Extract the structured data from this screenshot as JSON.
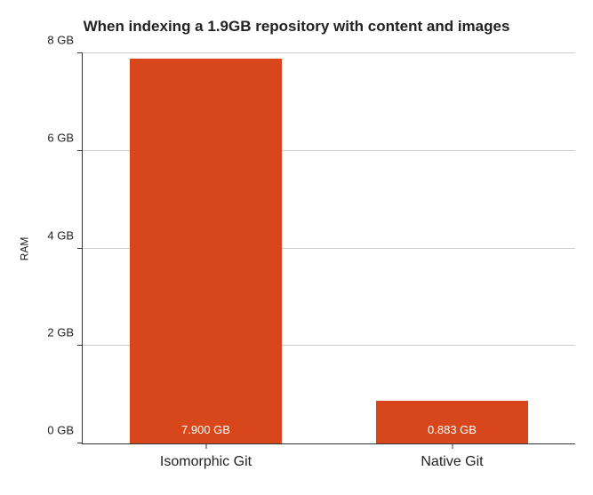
{
  "chart_data": {
    "type": "bar",
    "title": "When indexing a 1.9GB repository with content and images",
    "ylabel": "RAM",
    "xlabel": "",
    "categories": [
      "Isomorphic Git",
      "Native Git"
    ],
    "values": [
      7.9,
      0.883
    ],
    "value_labels": [
      "7.900 GB",
      "0.883 GB"
    ],
    "ylim": [
      0,
      8
    ],
    "y_ticks": [
      0,
      2,
      4,
      6,
      8
    ],
    "y_tick_labels": [
      "0 GB",
      "2 GB",
      "4 GB",
      "6 GB",
      "8 GB"
    ],
    "bar_color": "#d7471b"
  }
}
